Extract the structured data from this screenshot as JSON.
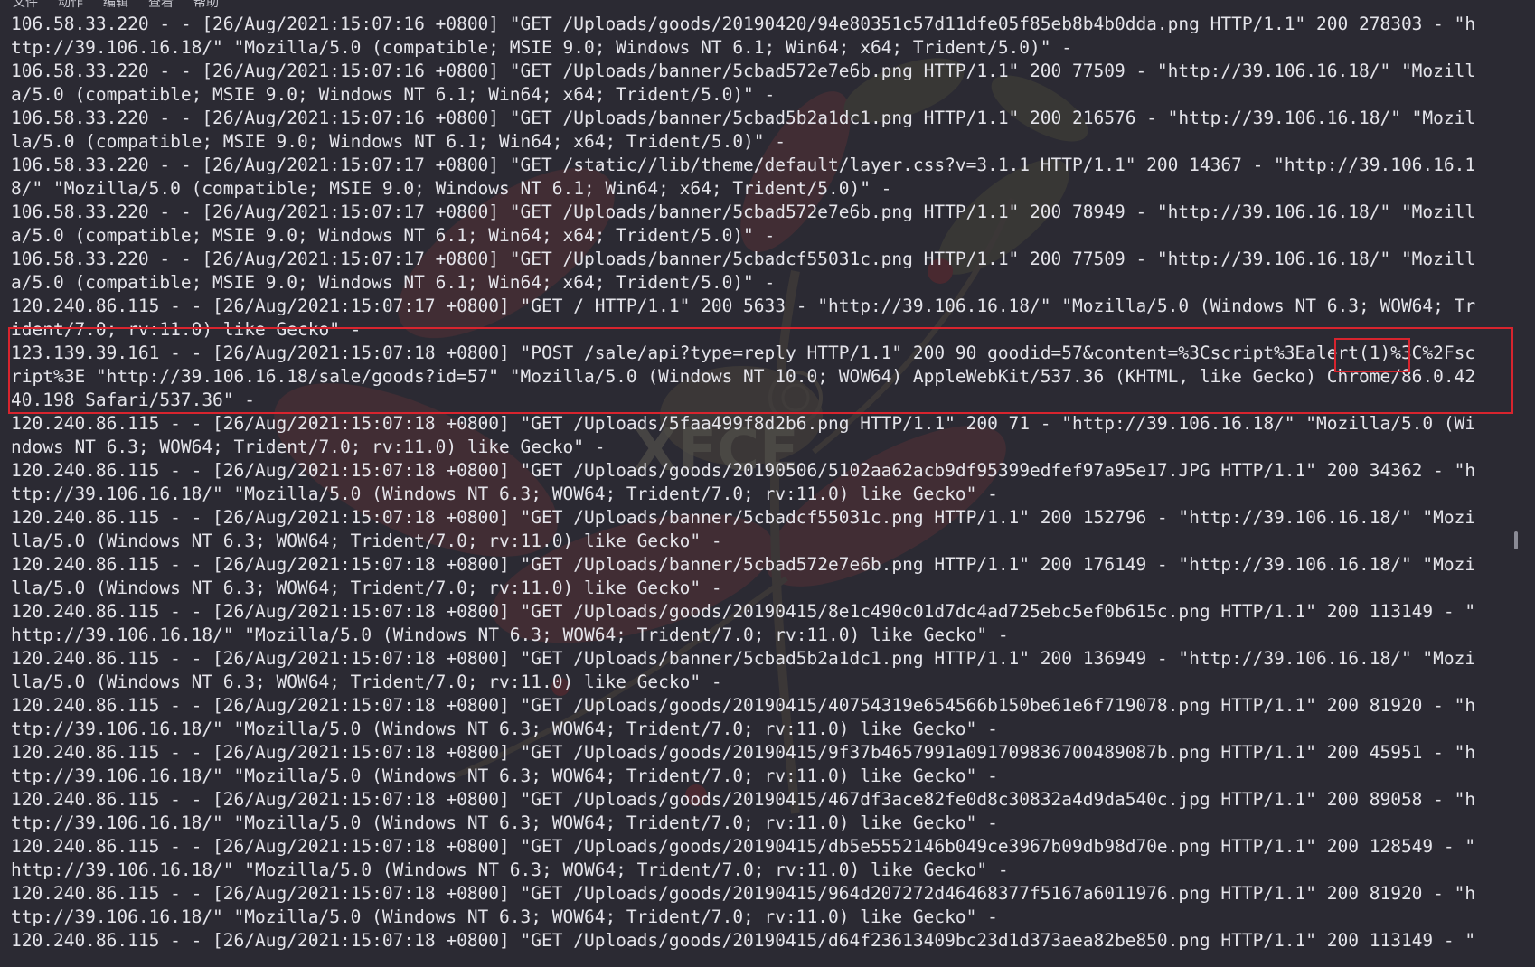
{
  "menubar": {
    "items": [
      "文件",
      "动作",
      "编辑",
      "查看",
      "帮助"
    ]
  },
  "watermark": {
    "text": "XFCE"
  },
  "colors": {
    "background": "#2b2a33",
    "text": "#e4e4ea",
    "highlight": "#d8242e"
  },
  "log_lines": [
    "106.58.33.220 - - [26/Aug/2021:15:07:16 +0800] \"GET /Uploads/goods/20190420/94e80351c57d11dfe05f85eb8b4b0dda.png HTTP/1.1\" 200 278303 - \"h",
    "ttp://39.106.16.18/\" \"Mozilla/5.0 (compatible; MSIE 9.0; Windows NT 6.1; Win64; x64; Trident/5.0)\" -",
    "106.58.33.220 - - [26/Aug/2021:15:07:16 +0800] \"GET /Uploads/banner/5cbad572e7e6b.png HTTP/1.1\" 200 77509 - \"http://39.106.16.18/\" \"Mozill",
    "a/5.0 (compatible; MSIE 9.0; Windows NT 6.1; Win64; x64; Trident/5.0)\" -",
    "106.58.33.220 - - [26/Aug/2021:15:07:16 +0800] \"GET /Uploads/banner/5cbad5b2a1dc1.png HTTP/1.1\" 200 216576 - \"http://39.106.16.18/\" \"Mozil",
    "la/5.0 (compatible; MSIE 9.0; Windows NT 6.1; Win64; x64; Trident/5.0)\" -",
    "106.58.33.220 - - [26/Aug/2021:15:07:17 +0800] \"GET /static//lib/theme/default/layer.css?v=3.1.1 HTTP/1.1\" 200 14367 - \"http://39.106.16.1",
    "8/\" \"Mozilla/5.0 (compatible; MSIE 9.0; Windows NT 6.1; Win64; x64; Trident/5.0)\" -",
    "106.58.33.220 - - [26/Aug/2021:15:07:17 +0800] \"GET /Uploads/banner/5cbad572e7e6b.png HTTP/1.1\" 200 78949 - \"http://39.106.16.18/\" \"Mozill",
    "a/5.0 (compatible; MSIE 9.0; Windows NT 6.1; Win64; x64; Trident/5.0)\" -",
    "106.58.33.220 - - [26/Aug/2021:15:07:17 +0800] \"GET /Uploads/banner/5cbadcf55031c.png HTTP/1.1\" 200 77509 - \"http://39.106.16.18/\" \"Mozill",
    "a/5.0 (compatible; MSIE 9.0; Windows NT 6.1; Win64; x64; Trident/5.0)\" -",
    "120.240.86.115 - - [26/Aug/2021:15:07:17 +0800] \"GET / HTTP/1.1\" 200 5633 - \"http://39.106.16.18/\" \"Mozilla/5.0 (Windows NT 6.3; WOW64; Tr",
    "ident/7.0; rv:11.0) like Gecko\" -",
    "123.139.39.161 - - [26/Aug/2021:15:07:18 +0800] \"POST /sale/api?type=reply HTTP/1.1\" 200 90 goodid=57&content=%3Cscript%3Ealert(1)%3C%2Fsc",
    "ript%3E \"http://39.106.16.18/sale/goods?id=57\" \"Mozilla/5.0 (Windows NT 10.0; WOW64) AppleWebKit/537.36 (KHTML, like Gecko) Chrome/86.0.42",
    "40.198 Safari/537.36\" -",
    "120.240.86.115 - - [26/Aug/2021:15:07:18 +0800] \"GET /Uploads/5faa499f8d2b6.png HTTP/1.1\" 200 71 - \"http://39.106.16.18/\" \"Mozilla/5.0 (Wi",
    "ndows NT 6.3; WOW64; Trident/7.0; rv:11.0) like Gecko\" -",
    "120.240.86.115 - - [26/Aug/2021:15:07:18 +0800] \"GET /Uploads/goods/20190506/5102aa62acb9df95399edfef97a95e17.JPG HTTP/1.1\" 200 34362 - \"h",
    "ttp://39.106.16.18/\" \"Mozilla/5.0 (Windows NT 6.3; WOW64; Trident/7.0; rv:11.0) like Gecko\" -",
    "120.240.86.115 - - [26/Aug/2021:15:07:18 +0800] \"GET /Uploads/banner/5cbadcf55031c.png HTTP/1.1\" 200 152796 - \"http://39.106.16.18/\" \"Mozi",
    "lla/5.0 (Windows NT 6.3; WOW64; Trident/7.0; rv:11.0) like Gecko\" -",
    "120.240.86.115 - - [26/Aug/2021:15:07:18 +0800] \"GET /Uploads/banner/5cbad572e7e6b.png HTTP/1.1\" 200 176149 - \"http://39.106.16.18/\" \"Mozi",
    "lla/5.0 (Windows NT 6.3; WOW64; Trident/7.0; rv:11.0) like Gecko\" -",
    "120.240.86.115 - - [26/Aug/2021:15:07:18 +0800] \"GET /Uploads/goods/20190415/8e1c490c01d7dc4ad725ebc5ef0b615c.png HTTP/1.1\" 200 113149 - \"",
    "http://39.106.16.18/\" \"Mozilla/5.0 (Windows NT 6.3; WOW64; Trident/7.0; rv:11.0) like Gecko\" -",
    "120.240.86.115 - - [26/Aug/2021:15:07:18 +0800] \"GET /Uploads/banner/5cbad5b2a1dc1.png HTTP/1.1\" 200 136949 - \"http://39.106.16.18/\" \"Mozi",
    "lla/5.0 (Windows NT 6.3; WOW64; Trident/7.0; rv:11.0) like Gecko\" -",
    "120.240.86.115 - - [26/Aug/2021:15:07:18 +0800] \"GET /Uploads/goods/20190415/40754319e654566b150be61e6f719078.png HTTP/1.1\" 200 81920 - \"h",
    "ttp://39.106.16.18/\" \"Mozilla/5.0 (Windows NT 6.3; WOW64; Trident/7.0; rv:11.0) like Gecko\" -",
    "120.240.86.115 - - [26/Aug/2021:15:07:18 +0800] \"GET /Uploads/goods/20190415/9f37b4657991a091709836700489087b.png HTTP/1.1\" 200 45951 - \"h",
    "ttp://39.106.16.18/\" \"Mozilla/5.0 (Windows NT 6.3; WOW64; Trident/7.0; rv:11.0) like Gecko\" -",
    "120.240.86.115 - - [26/Aug/2021:15:07:18 +0800] \"GET /Uploads/goods/20190415/467df3ace82fe0d8c30832a4d9da540c.jpg HTTP/1.1\" 200 89058 - \"h",
    "ttp://39.106.16.18/\" \"Mozilla/5.0 (Windows NT 6.3; WOW64; Trident/7.0; rv:11.0) like Gecko\" -",
    "120.240.86.115 - - [26/Aug/2021:15:07:18 +0800] \"GET /Uploads/goods/20190415/db5e5552146b049ce3967b09db98d70e.png HTTP/1.1\" 200 128549 - \"",
    "http://39.106.16.18/\" \"Mozilla/5.0 (Windows NT 6.3; WOW64; Trident/7.0; rv:11.0) like Gecko\" -",
    "120.240.86.115 - - [26/Aug/2021:15:07:18 +0800] \"GET /Uploads/goods/20190415/964d207272d46468377f5167a6011976.png HTTP/1.1\" 200 81920 - \"h",
    "ttp://39.106.16.18/\" \"Mozilla/5.0 (Windows NT 6.3; WOW64; Trident/7.0; rv:11.0) like Gecko\" -",
    "120.240.86.115 - - [26/Aug/2021:15:07:18 +0800] \"GET /Uploads/goods/20190415/d64f23613409bc23d1d373aea82be850.png HTTP/1.1\" 200 113149 - \""
  ]
}
